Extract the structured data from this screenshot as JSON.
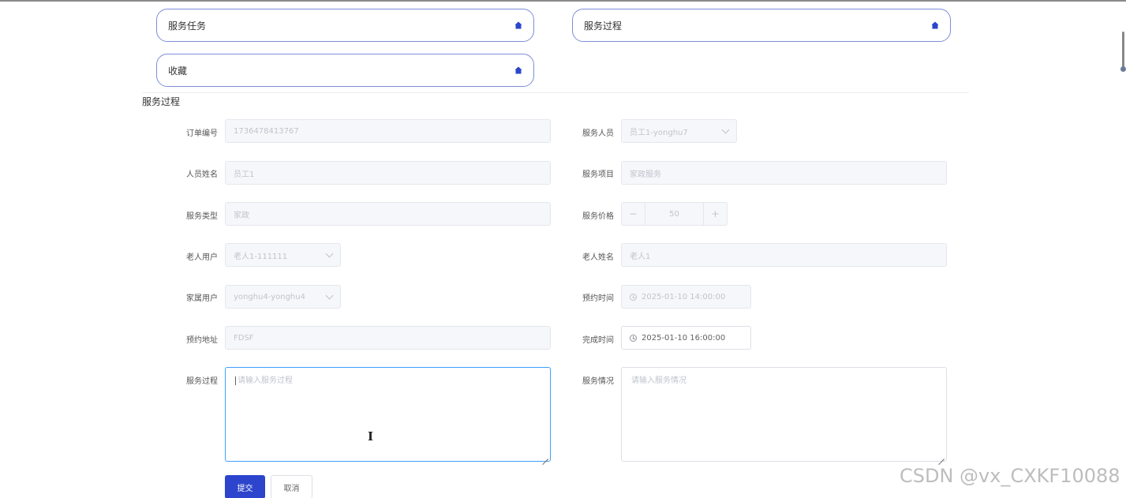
{
  "nav_cards": [
    {
      "label": "服务任务",
      "icon": "home-icon"
    },
    {
      "label": "服务过程",
      "icon": "home-icon"
    },
    {
      "label": "收藏",
      "icon": "home-icon"
    }
  ],
  "section": {
    "title": "服务过程"
  },
  "form": {
    "order_no": {
      "label": "订单编号",
      "value": "1736478413767"
    },
    "staff": {
      "label": "服务人员",
      "value": "员工1-yonghu7"
    },
    "staff_name": {
      "label": "人员姓名",
      "value": "员工1"
    },
    "service_item": {
      "label": "服务项目",
      "value": "家政服务"
    },
    "service_type": {
      "label": "服务类型",
      "value": "家政"
    },
    "price": {
      "label": "服务价格",
      "value": "50",
      "minus": "−",
      "plus": "+"
    },
    "elder_user": {
      "label": "老人用户",
      "value": "老人1-111111"
    },
    "elder_name": {
      "label": "老人姓名",
      "value": "老人1"
    },
    "family_user": {
      "label": "家属用户",
      "value": "yonghu4-yonghu4"
    },
    "appointment_time": {
      "label": "预约时间",
      "value": "2025-01-10 14:00:00"
    },
    "address": {
      "label": "预约地址",
      "value": "FDSF"
    },
    "finish_time": {
      "label": "完成时间",
      "value": "2025-01-10 16:00:00"
    },
    "process": {
      "label": "服务过程",
      "placeholder": "请输入服务过程"
    },
    "situation": {
      "label": "服务情况",
      "placeholder": "请输入服务情况"
    }
  },
  "actions": {
    "submit": "提交",
    "cancel": "取消"
  },
  "watermark": "CSDN @vx_CXKF10088",
  "colors": {
    "accent": "#2c45cc",
    "card_border": "#7e8ed8",
    "focus": "#409eff"
  }
}
